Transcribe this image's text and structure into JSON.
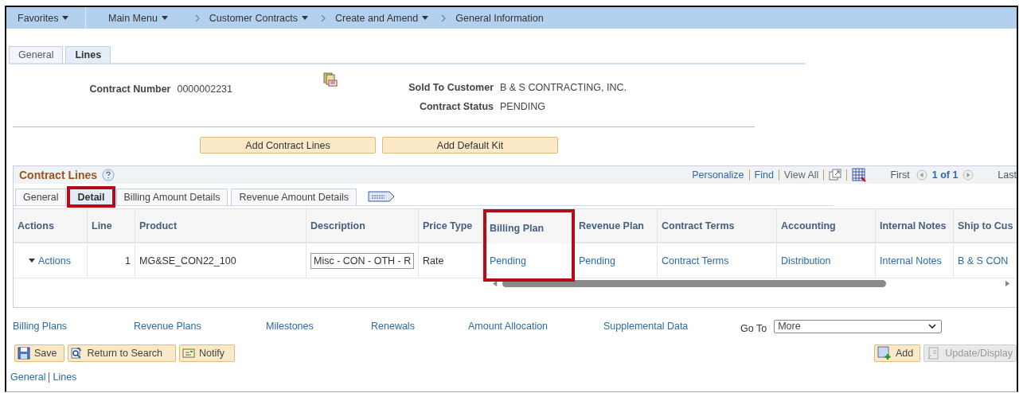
{
  "breadcrumb": [
    {
      "label": "Favorites",
      "dropdown": true
    },
    {
      "label": "Main Menu",
      "dropdown": true
    },
    {
      "label": "Customer Contracts",
      "dropdown": true
    },
    {
      "label": "Create and Amend",
      "dropdown": true
    },
    {
      "label": "General Information",
      "dropdown": false
    }
  ],
  "page_tabs": [
    {
      "label": "General",
      "selected": false
    },
    {
      "label": "Lines",
      "selected": true
    }
  ],
  "header": {
    "contract_number": {
      "label": "Contract Number",
      "value": "0000002231"
    },
    "sold_to_customer": {
      "label": "Sold To Customer",
      "value": "B & S CONTRACTING, INC."
    },
    "contract_status": {
      "label": "Contract Status",
      "value": "PENDING"
    }
  },
  "action_buttons": [
    "Add Contract Lines",
    "Add Default Kit"
  ],
  "grid": {
    "title": "Contract Lines",
    "toolbar_links": [
      "Personalize",
      "Find",
      "View All"
    ],
    "first": "First",
    "count": "1 of 1",
    "last": "Last",
    "tabs": [
      {
        "label": "General",
        "selected": false,
        "highlighted": false
      },
      {
        "label": "Detail",
        "selected": true,
        "highlighted": true
      },
      {
        "label": "Billing Amount Details",
        "selected": false,
        "highlighted": false
      },
      {
        "label": "Revenue Amount Details",
        "selected": false,
        "highlighted": false
      }
    ],
    "columns": [
      {
        "label": "Actions",
        "highlighted": false
      },
      {
        "label": "Line",
        "highlighted": false
      },
      {
        "label": "Product",
        "highlighted": false
      },
      {
        "label": "Description",
        "highlighted": false
      },
      {
        "label": "Price Type",
        "highlighted": false
      },
      {
        "label": "Billing Plan",
        "highlighted": true
      },
      {
        "label": "Revenue Plan",
        "highlighted": false
      },
      {
        "label": "Contract Terms",
        "highlighted": false
      },
      {
        "label": "Accounting",
        "highlighted": false
      },
      {
        "label": "Internal Notes",
        "highlighted": false
      },
      {
        "label": "Ship to Cus",
        "highlighted": false
      }
    ],
    "rows": [
      {
        "cells": [
          {
            "kind": "menu",
            "text": "Actions"
          },
          {
            "kind": "number",
            "text": "1"
          },
          {
            "kind": "text",
            "text": "MG&SE_CON22_100"
          },
          {
            "kind": "input",
            "text": "Misc - CON - OTH - R"
          },
          {
            "kind": "text",
            "text": "Rate"
          },
          {
            "kind": "link",
            "text": "Pending"
          },
          {
            "kind": "link",
            "text": "Pending"
          },
          {
            "kind": "link",
            "text": "Contract Terms"
          },
          {
            "kind": "link",
            "text": "Distribution"
          },
          {
            "kind": "link",
            "text": "Internal Notes"
          },
          {
            "kind": "link",
            "text": "B & S CON"
          }
        ]
      }
    ]
  },
  "links": [
    "Billing Plans",
    "Revenue Plans",
    "Milestones",
    "Renewals",
    "Amount Allocation",
    "Supplemental Data"
  ],
  "go_to": {
    "label": "Go To",
    "value": "More"
  },
  "footer_buttons": [
    {
      "kind": "save",
      "label": "Save",
      "disabled": false
    },
    {
      "kind": "return",
      "label": "Return to Search",
      "disabled": false
    },
    {
      "kind": "notify",
      "label": "Notify",
      "disabled": false
    }
  ],
  "right_buttons": [
    {
      "kind": "add",
      "label": "Add",
      "disabled": false
    },
    {
      "kind": "update",
      "label": "Update/Display",
      "disabled": true
    }
  ],
  "bottom_links": [
    "General",
    "Lines"
  ]
}
